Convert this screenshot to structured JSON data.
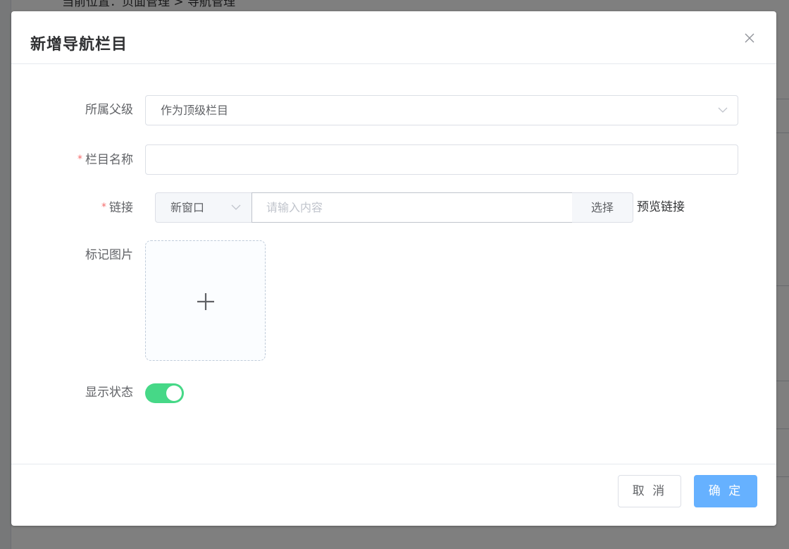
{
  "background": {
    "breadcrumb": "当前位置：页面管理 > 导航管理"
  },
  "dialog": {
    "title": "新增导航栏目",
    "close_icon": "close-icon"
  },
  "form": {
    "parent": {
      "label": "所属父级",
      "selected": "作为顶级栏目"
    },
    "name": {
      "label": "栏目名称",
      "required_mark": "*",
      "value": ""
    },
    "link": {
      "label": "链接",
      "required_mark": "*",
      "target_selected": "新窗口",
      "placeholder": "请输入内容",
      "value": "",
      "select_button": "选择",
      "preview_label": "预览链接"
    },
    "image": {
      "label": "标记图片",
      "upload_icon": "plus-icon"
    },
    "status": {
      "label": "显示状态",
      "enabled": true,
      "active_color": "#13ce66"
    }
  },
  "footer": {
    "cancel_label": "取 消",
    "confirm_label": "确 定",
    "primary_color": "#66b1ff"
  }
}
